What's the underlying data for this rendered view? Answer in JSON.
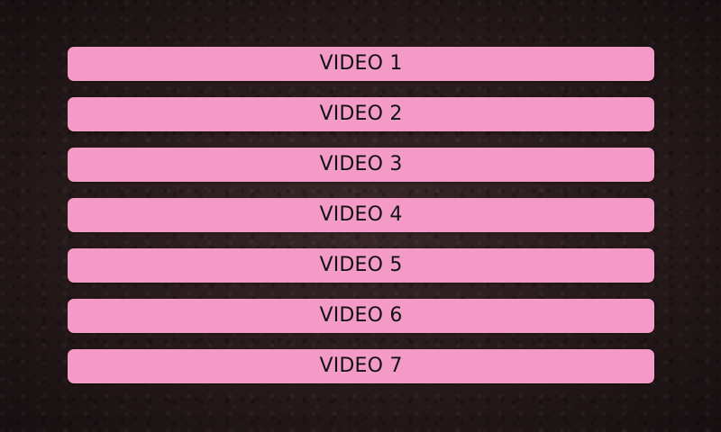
{
  "videos": [
    {
      "label": "VIDEO 1"
    },
    {
      "label": "VIDEO 2"
    },
    {
      "label": "VIDEO 3"
    },
    {
      "label": "VIDEO 4"
    },
    {
      "label": "VIDEO 5"
    },
    {
      "label": "VIDEO 6"
    },
    {
      "label": "VIDEO 7"
    }
  ],
  "colors": {
    "button_background": "#f49ac7",
    "button_text": "#111111",
    "background": "#2e2021"
  }
}
